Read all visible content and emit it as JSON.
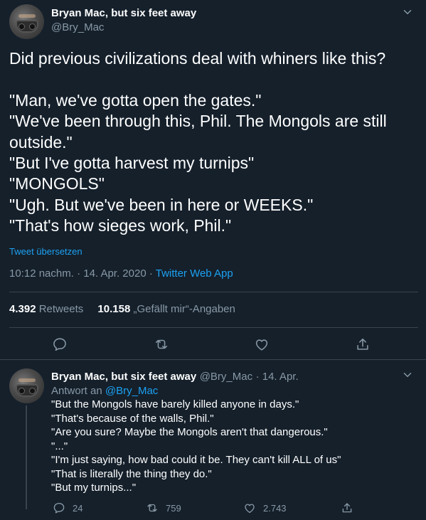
{
  "colors": {
    "background": "#15202b",
    "text": "#ffffff",
    "muted": "#8899a6",
    "accent": "#1da1f2",
    "divider": "#38444d"
  },
  "main_tweet": {
    "author_name": "Bryan Mac, but six feet away",
    "author_handle": "@Bry_Mac",
    "text": "Did previous civilizations deal with whiners like this?\n\n\"Man, we've gotta open the gates.\"\n\"We've been through this, Phil. The Mongols are still outside.\"\n\"But I've gotta harvest my turnips\"\n\"MONGOLS\"\n\"Ugh. But we've been in here or WEEKS.\"\n\"That's how sieges work, Phil.\"",
    "translate_label": "Tweet übersetzen",
    "time": "10:12 nachm.",
    "separator1": " · ",
    "date": "14. Apr. 2020",
    "separator2": " · ",
    "source": "Twitter Web App",
    "retweets_count": "4.392",
    "retweets_label": "Retweets",
    "likes_count": "10.158",
    "likes_label": "„Gefällt mir“-Angaben",
    "icons": [
      "reply-icon",
      "retweet-icon",
      "like-icon",
      "share-icon"
    ]
  },
  "reply_tweet": {
    "author_name": "Bryan Mac, but six feet away",
    "author_handle": "@Bry_Mac",
    "date": "· 14. Apr.",
    "reply_to_label": "Antwort an",
    "reply_to_handle": "@Bry_Mac",
    "text": "\"But the Mongols have barely killed anyone in days.\"\n\"That's because of the walls, Phil.\"\n\"Are you sure? Maybe the Mongols aren't that dangerous.\"\n\"...\"\n\"I'm just saying, how bad could it be. They can't kill ALL of us\"\n\"That is literally the thing they do.\"\n\"But my turnips...\"",
    "replies": "24",
    "retweets": "759",
    "likes": "2.743",
    "icons": [
      "reply-icon",
      "retweet-icon",
      "like-icon",
      "share-icon"
    ]
  }
}
